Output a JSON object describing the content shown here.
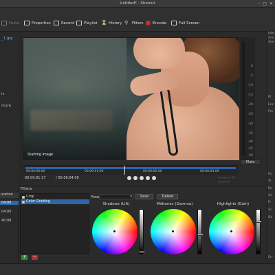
{
  "window": {
    "title": "Untitled* - Shotcut",
    "controls": [
      "–",
      "□",
      "✕"
    ]
  },
  "toolbar": {
    "items": [
      {
        "label": "Paste",
        "icon": "paste-icon",
        "enabled": false
      },
      {
        "label": "Properties",
        "icon": "properties-icon"
      },
      {
        "label": "Recent",
        "icon": "recent-icon"
      },
      {
        "label": "Playlist",
        "icon": "playlist-icon"
      },
      {
        "label": "History",
        "icon": "history-icon"
      },
      {
        "label": "Filters",
        "icon": "filters-icon"
      },
      {
        "label": "Encode",
        "icon": "encode-icon"
      },
      {
        "label": "Full Screen",
        "icon": "fullscreen-icon"
      }
    ]
  },
  "left_panel": {
    "file_name": "_1.jpg",
    "label_1": "ic",
    "label_2": "cture"
  },
  "player": {
    "caption": "Starting image",
    "meter_ticks": [
      "0",
      "-5",
      "-10",
      "-15",
      "-20",
      "-25",
      "-30",
      "-35",
      "-40",
      "-45",
      "-50"
    ],
    "mute_label": "Mute",
    "ruler_ticks": [
      "00:00:00:00",
      "00:00:01:00",
      "00:00:02:00",
      "00:00:03:00"
    ],
    "timecode_current": "00:00:01:17",
    "timecode_total": "/ 00:00:04:00",
    "inout": "--:--:--:-- / --:--:--:--"
  },
  "right_panel": {
    "labels": [
      "Jobs",
      "/hor",
      "/hor",
      "Pl",
      "Enc",
      "Pre",
      "Fo",
      "Vi",
      "Re",
      "As",
      "Fr",
      "Sc",
      "De",
      "Err"
    ]
  },
  "duration_panel": {
    "header": "uration",
    "rows": [
      "04:00",
      "04:00",
      "40:08"
    ]
  },
  "filters_panel": {
    "title": "Filters",
    "filters": [
      {
        "name": "Crop",
        "checked": true,
        "selected": false
      },
      {
        "name": "Color Grading",
        "checked": true,
        "selected": true
      }
    ],
    "add_label": "+",
    "remove_label": "−",
    "preset_label": "Preset",
    "save_label": "Save",
    "delete_label": "Delete",
    "wheels": [
      {
        "label": "Shadows (Lift)",
        "level": 0.05
      },
      {
        "label": "Midtones (Gamma)",
        "level": 0.45
      },
      {
        "label": "Highlights (Gain)",
        "level": 0.75
      }
    ]
  },
  "colors": {
    "accent": "#2e66a8",
    "timeline_bar": "#2a62b0",
    "record": "#c93030"
  }
}
